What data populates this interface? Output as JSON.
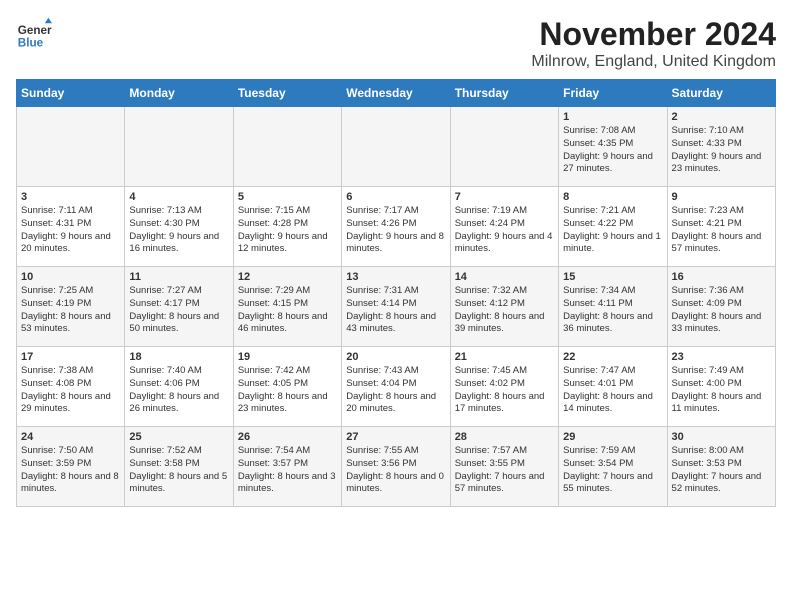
{
  "logo": {
    "line1": "General",
    "line2": "Blue"
  },
  "title": "November 2024",
  "subtitle": "Milnrow, England, United Kingdom",
  "days_of_week": [
    "Sunday",
    "Monday",
    "Tuesday",
    "Wednesday",
    "Thursday",
    "Friday",
    "Saturday"
  ],
  "weeks": [
    [
      {
        "day": "",
        "info": ""
      },
      {
        "day": "",
        "info": ""
      },
      {
        "day": "",
        "info": ""
      },
      {
        "day": "",
        "info": ""
      },
      {
        "day": "",
        "info": ""
      },
      {
        "day": "1",
        "info": "Sunrise: 7:08 AM\nSunset: 4:35 PM\nDaylight: 9 hours and 27 minutes."
      },
      {
        "day": "2",
        "info": "Sunrise: 7:10 AM\nSunset: 4:33 PM\nDaylight: 9 hours and 23 minutes."
      }
    ],
    [
      {
        "day": "3",
        "info": "Sunrise: 7:11 AM\nSunset: 4:31 PM\nDaylight: 9 hours and 20 minutes."
      },
      {
        "day": "4",
        "info": "Sunrise: 7:13 AM\nSunset: 4:30 PM\nDaylight: 9 hours and 16 minutes."
      },
      {
        "day": "5",
        "info": "Sunrise: 7:15 AM\nSunset: 4:28 PM\nDaylight: 9 hours and 12 minutes."
      },
      {
        "day": "6",
        "info": "Sunrise: 7:17 AM\nSunset: 4:26 PM\nDaylight: 9 hours and 8 minutes."
      },
      {
        "day": "7",
        "info": "Sunrise: 7:19 AM\nSunset: 4:24 PM\nDaylight: 9 hours and 4 minutes."
      },
      {
        "day": "8",
        "info": "Sunrise: 7:21 AM\nSunset: 4:22 PM\nDaylight: 9 hours and 1 minute."
      },
      {
        "day": "9",
        "info": "Sunrise: 7:23 AM\nSunset: 4:21 PM\nDaylight: 8 hours and 57 minutes."
      }
    ],
    [
      {
        "day": "10",
        "info": "Sunrise: 7:25 AM\nSunset: 4:19 PM\nDaylight: 8 hours and 53 minutes."
      },
      {
        "day": "11",
        "info": "Sunrise: 7:27 AM\nSunset: 4:17 PM\nDaylight: 8 hours and 50 minutes."
      },
      {
        "day": "12",
        "info": "Sunrise: 7:29 AM\nSunset: 4:15 PM\nDaylight: 8 hours and 46 minutes."
      },
      {
        "day": "13",
        "info": "Sunrise: 7:31 AM\nSunset: 4:14 PM\nDaylight: 8 hours and 43 minutes."
      },
      {
        "day": "14",
        "info": "Sunrise: 7:32 AM\nSunset: 4:12 PM\nDaylight: 8 hours and 39 minutes."
      },
      {
        "day": "15",
        "info": "Sunrise: 7:34 AM\nSunset: 4:11 PM\nDaylight: 8 hours and 36 minutes."
      },
      {
        "day": "16",
        "info": "Sunrise: 7:36 AM\nSunset: 4:09 PM\nDaylight: 8 hours and 33 minutes."
      }
    ],
    [
      {
        "day": "17",
        "info": "Sunrise: 7:38 AM\nSunset: 4:08 PM\nDaylight: 8 hours and 29 minutes."
      },
      {
        "day": "18",
        "info": "Sunrise: 7:40 AM\nSunset: 4:06 PM\nDaylight: 8 hours and 26 minutes."
      },
      {
        "day": "19",
        "info": "Sunrise: 7:42 AM\nSunset: 4:05 PM\nDaylight: 8 hours and 23 minutes."
      },
      {
        "day": "20",
        "info": "Sunrise: 7:43 AM\nSunset: 4:04 PM\nDaylight: 8 hours and 20 minutes."
      },
      {
        "day": "21",
        "info": "Sunrise: 7:45 AM\nSunset: 4:02 PM\nDaylight: 8 hours and 17 minutes."
      },
      {
        "day": "22",
        "info": "Sunrise: 7:47 AM\nSunset: 4:01 PM\nDaylight: 8 hours and 14 minutes."
      },
      {
        "day": "23",
        "info": "Sunrise: 7:49 AM\nSunset: 4:00 PM\nDaylight: 8 hours and 11 minutes."
      }
    ],
    [
      {
        "day": "24",
        "info": "Sunrise: 7:50 AM\nSunset: 3:59 PM\nDaylight: 8 hours and 8 minutes."
      },
      {
        "day": "25",
        "info": "Sunrise: 7:52 AM\nSunset: 3:58 PM\nDaylight: 8 hours and 5 minutes."
      },
      {
        "day": "26",
        "info": "Sunrise: 7:54 AM\nSunset: 3:57 PM\nDaylight: 8 hours and 3 minutes."
      },
      {
        "day": "27",
        "info": "Sunrise: 7:55 AM\nSunset: 3:56 PM\nDaylight: 8 hours and 0 minutes."
      },
      {
        "day": "28",
        "info": "Sunrise: 7:57 AM\nSunset: 3:55 PM\nDaylight: 7 hours and 57 minutes."
      },
      {
        "day": "29",
        "info": "Sunrise: 7:59 AM\nSunset: 3:54 PM\nDaylight: 7 hours and 55 minutes."
      },
      {
        "day": "30",
        "info": "Sunrise: 8:00 AM\nSunset: 3:53 PM\nDaylight: 7 hours and 52 minutes."
      }
    ]
  ],
  "colors": {
    "header_bg": "#2e7abf",
    "odd_row_bg": "#f5f5f5",
    "even_row_bg": "#ffffff"
  }
}
